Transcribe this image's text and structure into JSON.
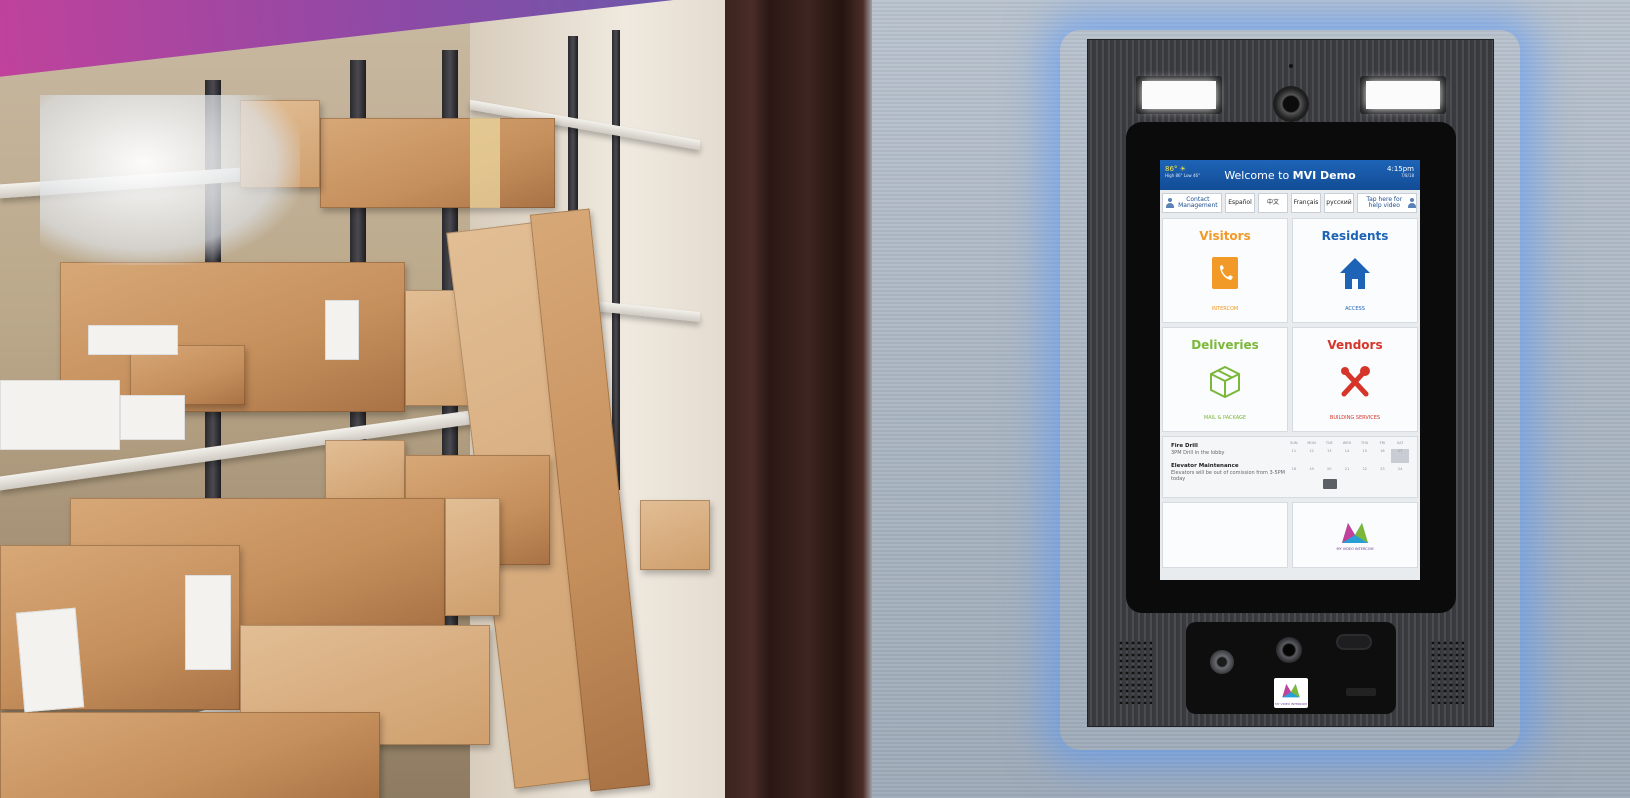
{
  "scene": "MVI Demo",
  "screen": {
    "weather": {
      "temp": "86°",
      "range": "High 86° Low 46°"
    },
    "welcome_prefix": "Welcome to",
    "welcome_name": "MVI Demo",
    "time": "4:15pm",
    "date": "7/8/18",
    "languages": [
      {
        "label": "Contact Management"
      },
      {
        "label": "Español"
      },
      {
        "label": "中文"
      },
      {
        "label": "Français"
      },
      {
        "label": "русский"
      },
      {
        "label": "Tap here for help video"
      }
    ],
    "tiles": [
      {
        "title": "Visitors",
        "subtitle": "INTERCOM",
        "color": "#f29a28",
        "icon": "phone-icon"
      },
      {
        "title": "Residents",
        "subtitle": "ACCESS",
        "color": "#1d64b6",
        "icon": "house-icon"
      },
      {
        "title": "Deliveries",
        "subtitle": "MAIL & PACKAGE",
        "color": "#7bb83a",
        "icon": "package-icon"
      },
      {
        "title": "Vendors",
        "subtitle": "BUILDING SERVICES",
        "color": "#d6352a",
        "icon": "tools-icon"
      }
    ],
    "events": [
      {
        "title": "Fire Drill",
        "detail": "3PM Drill in the lobby"
      },
      {
        "title": "Elevator Maintenance",
        "detail": "Elevators will be out of comission from 3-5PM today"
      }
    ],
    "calendar_days": [
      "SUN",
      "MON",
      "TUE",
      "WED",
      "THU",
      "FRI",
      "SAT"
    ],
    "calendar_weeks": [
      [
        "11",
        "12",
        "13",
        "14",
        "15",
        "16",
        "17"
      ],
      [
        "18",
        "19",
        "20",
        "21",
        "22",
        "23",
        "24"
      ]
    ],
    "logo_text": "MY VIDEO INTERCOM"
  },
  "console": {
    "sticker_text": "MY VIDEO INTERCOM"
  }
}
